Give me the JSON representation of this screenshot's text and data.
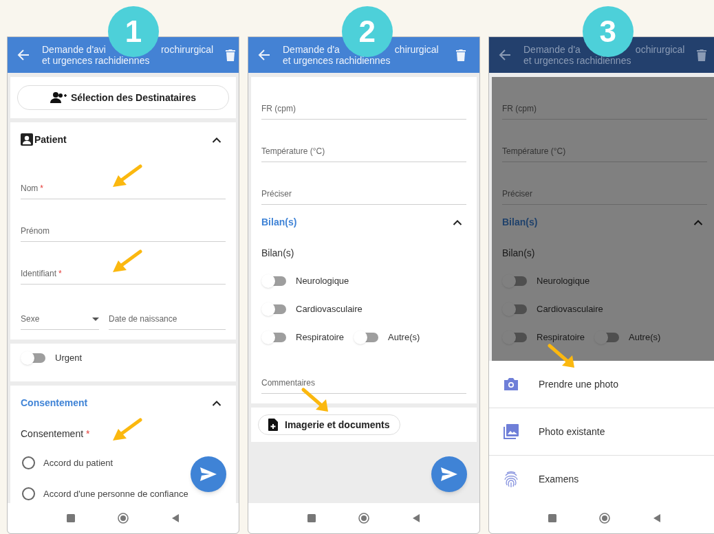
{
  "screens": [
    {
      "number": "1",
      "dimmed": false,
      "title": [
        [
          "Demande d'avi",
          "rochirurgical"
        ],
        [
          "et urgences rachidiennes"
        ]
      ],
      "fab": true,
      "cards": [
        {
          "kind": "recipients",
          "label": "Sélection des Destinataires"
        },
        {
          "kind": "form",
          "items": [
            {
              "kind": "title",
              "label": "Patient",
              "expanded": true
            },
            {
              "kind": "field",
              "label": "Nom",
              "required": "*",
              "arrow": true
            },
            {
              "kind": "field",
              "label": "Prénom"
            },
            {
              "kind": "field",
              "label": "Identifiant",
              "required": "*",
              "arrow": true
            },
            {
              "kind": "select_date",
              "select": "Sexe",
              "date": "Date de naissance"
            }
          ]
        },
        {
          "kind": "form",
          "items": [
            {
              "kind": "toggle",
              "label": "Urgent",
              "on": false
            }
          ]
        },
        {
          "kind": "form",
          "items": [
            {
              "kind": "header",
              "label": "Consentement",
              "expanded": true
            },
            {
              "kind": "group_label",
              "label": "Consentement",
              "required": "*",
              "arrow": true
            },
            {
              "kind": "radio",
              "label": "Accord du patient",
              "selected": false
            },
            {
              "kind": "radio",
              "label": "Accord d'une personne de confiance",
              "selected": false
            }
          ]
        }
      ]
    },
    {
      "number": "2",
      "dimmed": false,
      "title": [
        [
          "Demande d'a",
          "chirurgical"
        ],
        [
          "et urgences rachidiennes"
        ]
      ],
      "fab": true,
      "cards": [
        {
          "kind": "form",
          "items": [
            {
              "kind": "field",
              "label": "FR (cpm)"
            },
            {
              "kind": "field",
              "label": "Température (°C)"
            },
            {
              "kind": "field",
              "label": "Préciser"
            },
            {
              "kind": "header",
              "label": "Bilan(s)",
              "expanded": true
            },
            {
              "kind": "group_label",
              "label": "Bilan(s)"
            },
            {
              "kind": "toggle",
              "label": "Neurologique",
              "on": false
            },
            {
              "kind": "toggle",
              "label": "Cardiovasculaire",
              "on": false
            },
            {
              "kind": "toggle_row",
              "toggles": [
                {
                  "label": "Respiratoire",
                  "on": false
                },
                {
                  "label": "Autre(s)",
                  "on": false
                }
              ]
            },
            {
              "kind": "field",
              "label": "Commentaires"
            }
          ]
        },
        {
          "kind": "attachments",
          "label": "Imagerie et documents",
          "arrow": true
        }
      ]
    },
    {
      "number": "3",
      "dimmed": true,
      "title": [
        [
          "Demande d'a",
          "ochirurgical"
        ],
        [
          "et urgences rachidiennes"
        ]
      ],
      "fab": false,
      "cards": [
        {
          "kind": "form",
          "items": [
            {
              "kind": "field",
              "label": "FR (cpm)"
            },
            {
              "kind": "field",
              "label": "Température (°C)"
            },
            {
              "kind": "field",
              "label": "Préciser"
            },
            {
              "kind": "header",
              "label": "Bilan(s)",
              "expanded": true
            },
            {
              "kind": "group_label",
              "label": "Bilan(s)"
            },
            {
              "kind": "toggle",
              "label": "Neurologique",
              "on": false
            },
            {
              "kind": "toggle",
              "label": "Cardiovasculaire",
              "on": false
            },
            {
              "kind": "toggle_row",
              "toggles": [
                {
                  "label": "Respiratoire",
                  "on": false
                },
                {
                  "label": "Autre(s)",
                  "on": false
                }
              ]
            }
          ]
        }
      ],
      "sheet": [
        {
          "label": "Prendre une photo",
          "arrow": true
        },
        {
          "label": "Photo existante"
        },
        {
          "label": "Examens"
        }
      ]
    }
  ]
}
